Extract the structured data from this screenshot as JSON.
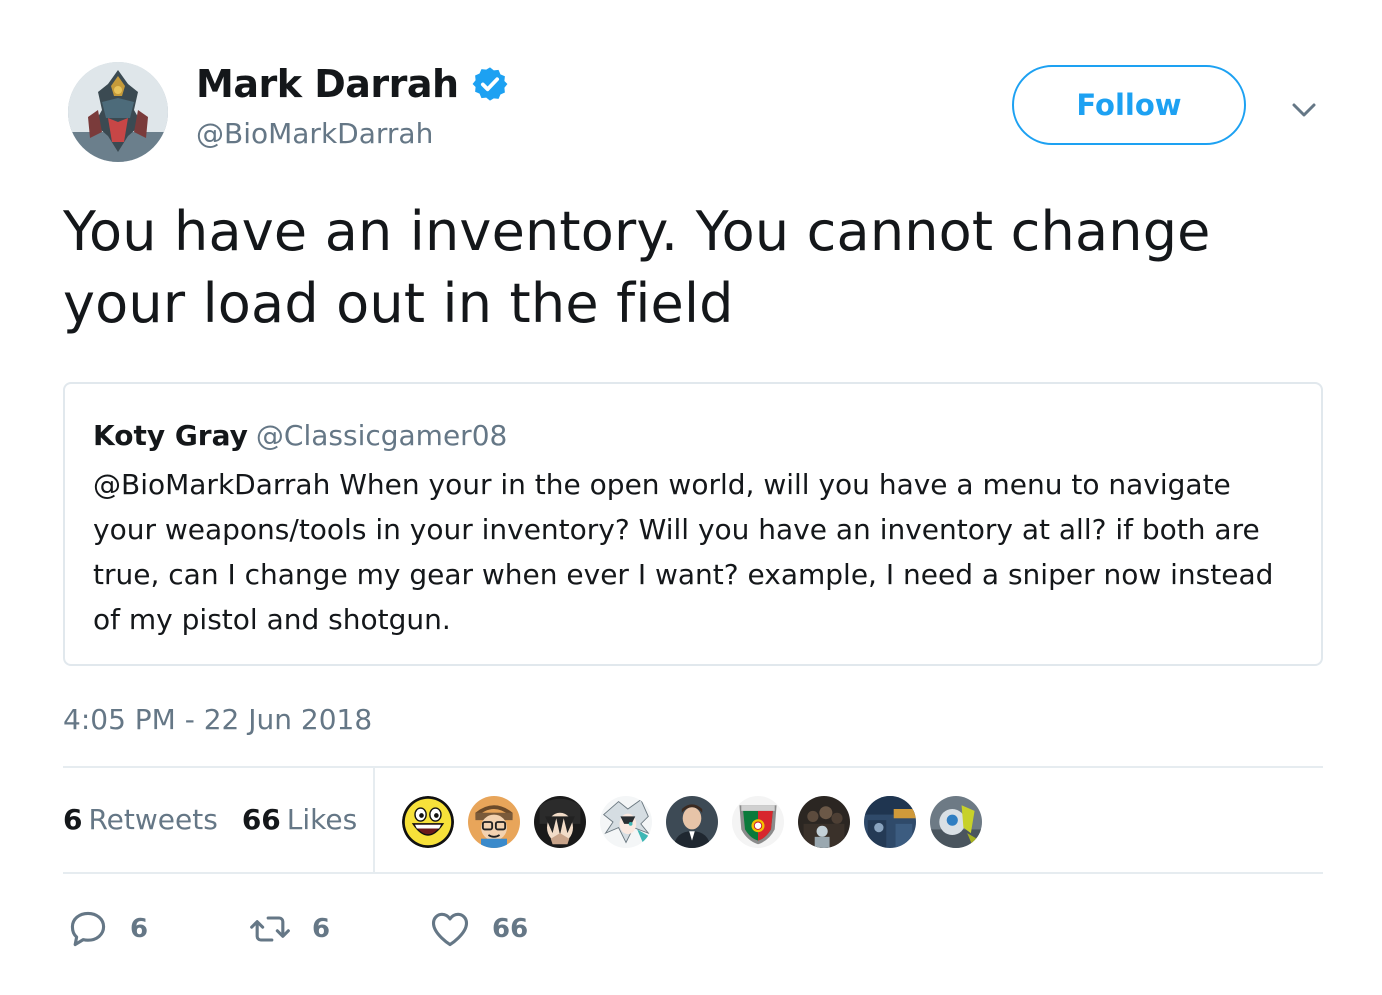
{
  "author": {
    "display_name": "Mark Darrah",
    "handle": "@BioMarkDarrah",
    "verified": true
  },
  "follow_button": {
    "label": "Follow"
  },
  "tweet": {
    "text": "You have an inventory. You cannot change your load out in the field"
  },
  "quoted_tweet": {
    "display_name": "Koty Gray",
    "handle": "@Classicgamer08",
    "text": "@BioMarkDarrah When your in the open world, will you have a menu to navigate your weapons/tools in your inventory? Will you have an inventory at all? if both are true, can I change my gear when ever I want? example, I need a sniper now instead of my pistol and shotgun."
  },
  "timestamp": "4:05 PM - 22 Jun 2018",
  "stats": {
    "retweets": {
      "count": "6",
      "label": "Retweets"
    },
    "likes": {
      "count": "66",
      "label": "Likes"
    }
  },
  "liker_avatars": [
    "awesome-face-avatar",
    "cartoon-glasses-avatar",
    "anime-dark-avatar",
    "anime-white-hair-avatar",
    "man-portrait-avatar",
    "portugal-shield-avatar",
    "dark-crowd-avatar",
    "blue-scene-avatar",
    "robot-yellow-avatar"
  ],
  "actions": {
    "reply": {
      "count": "6",
      "icon": "reply-icon"
    },
    "retweet": {
      "count": "6",
      "icon": "retweet-icon"
    },
    "like": {
      "count": "66",
      "icon": "heart-icon"
    }
  },
  "colors": {
    "accent": "#1da1f2",
    "text": "#14171a",
    "secondary": "#657786",
    "border": "#e1e8ed"
  }
}
